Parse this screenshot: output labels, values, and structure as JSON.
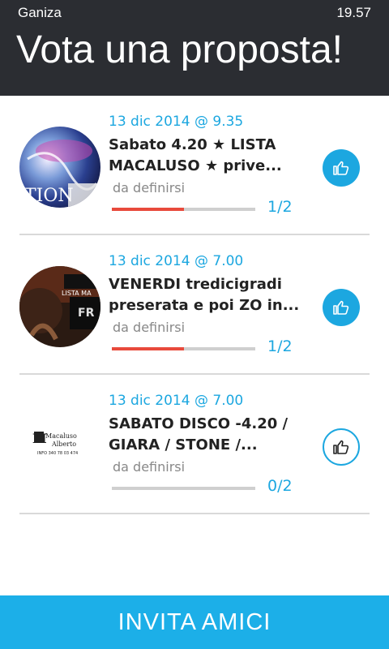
{
  "status": {
    "app_name": "Ganiza",
    "time": "19.57"
  },
  "header": {
    "title": "Vota una proposta!"
  },
  "proposals": [
    {
      "date": "13 dic 2014 @ 9.35",
      "title_line1": "Sabato 4.20 ★ LISTA",
      "title_line2": "MACALUSO ★ prive...",
      "place": "da definirsi",
      "votes": "1/2",
      "progress": 0.5,
      "liked": true,
      "image_text": "TION"
    },
    {
      "date": "13 dic 2014 @ 7.00",
      "title_line1": "VENERDI tredicigradi",
      "title_line2": "preserata e poi ZO in...",
      "place": "da definirsi",
      "votes": "1/2",
      "progress": 0.5,
      "liked": true,
      "image_text": "LISTA MA"
    },
    {
      "date": "13 dic 2014 @ 7.00",
      "title_line1": "SABATO DISCO -4.20 /",
      "title_line2": "GIARA / STONE /...",
      "place": "da definirsi",
      "votes": "0/2",
      "progress": 0,
      "liked": false,
      "logo_main": "Macaluso",
      "logo_sub": "Alberto",
      "logo_info": "INFO 340 78 03 474"
    }
  ],
  "footer": {
    "invite_label": "INVITA AMICI"
  },
  "colors": {
    "accent": "#1ca7e0",
    "progress": "#e84a3c",
    "header_bg": "#2b2d32"
  },
  "icons": {
    "like": "thumbs-up-icon"
  }
}
